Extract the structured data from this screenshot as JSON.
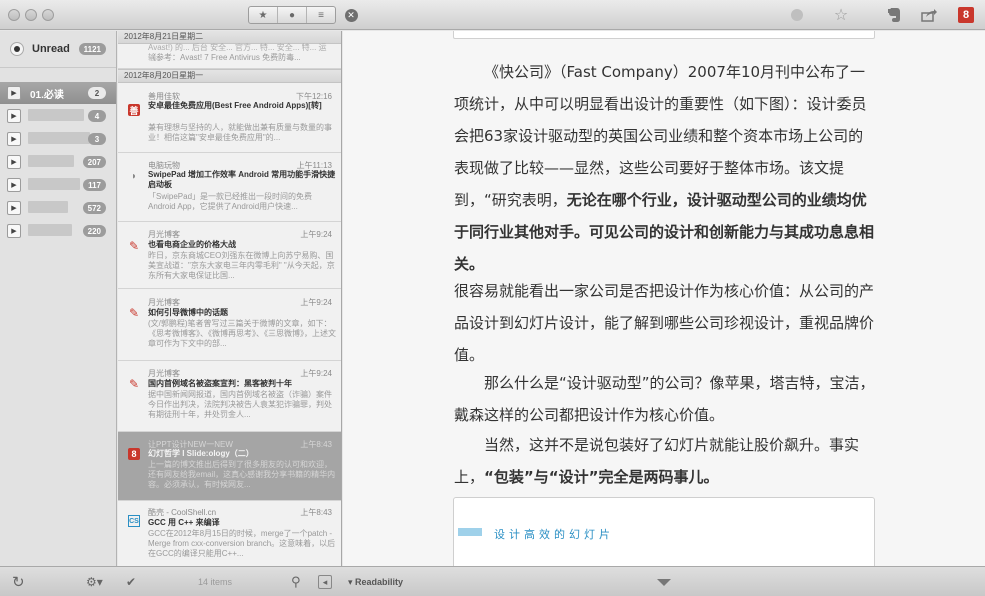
{
  "toolbar": {
    "segments": [
      "★",
      "●",
      "≡"
    ],
    "close_glyph": "✕",
    "star_glyph": "☆",
    "evernote_glyph": "🐘",
    "share_glyph": "⇪",
    "readitlater_glyph": "8"
  },
  "sidebar": {
    "unread_label": "Unread",
    "unread_count": "1121",
    "folders": [
      {
        "label": "01.必读",
        "count": "2"
      },
      {
        "label": "",
        "count": "4"
      },
      {
        "label": "",
        "count": "3"
      },
      {
        "label": "",
        "count": "207"
      },
      {
        "label": "",
        "count": "117"
      },
      {
        "label": "",
        "count": "572"
      },
      {
        "label": "",
        "count": "220"
      }
    ]
  },
  "list": {
    "partial_item": {
      "line1": "Avast!) 的... 后台 安全... 官方... 特... 安全... 特... 运输...",
      "line2": "（参考：Avast! 7 Free Antivirus 免费防毒..."
    },
    "date_headers": [
      "2012年8月21日星期二",
      "2012年8月20日星期一"
    ],
    "items": [
      {
        "source": "善用佳软",
        "time": "下午12:16",
        "title": "安卓最佳免费应用(Best Free Android Apps)[转]",
        "summary": "兼有理想与坚持的人，就能做出兼有质量与数量的事业！相信这篇\"安卓最佳免费应用\"的..."
      },
      {
        "source": "电脑玩物",
        "time": "上午11:13",
        "title": "SwipePad 增加工作效率 Android 常用功能手滑快捷启动板",
        "summary": "「SwipePad」是一款已经推出一段时间的免费Android App，它提供了Android用户快速..."
      },
      {
        "source": "月光博客",
        "time": "上午9:24",
        "title": "也看电商企业的价格大战",
        "summary": "昨日，京东商城CEO刘强东在微博上向苏宁易购、国美宣战道：\"京东大家电三年内零毛利\" \"从今天起，京东所有大家电保证比国..."
      },
      {
        "source": "月光博客",
        "time": "上午9:24",
        "title": "如何引导微博中的话题",
        "summary": "(文/郭鹏程)笔者曾写过三篇关于微博的文章，如下：《思考微博客》、《微博再思考》、《三思微博》，上述文章可作为下文中的部..."
      },
      {
        "source": "月光博客",
        "time": "上午9:24",
        "title": "国内首例域名被盗案宣判：黑客被判十年",
        "summary": "据中国新闻网报道，国内首例域名被盗（诈骗）案件今日作出判决，法院判决被告人袁某犯诈骗罪，判处有期徒刑十年，并处罚金人..."
      },
      {
        "source": "让PPT设计NEW一NEW",
        "time": "上午8:43",
        "title": "幻灯哲学 I Slide:ology（二）",
        "summary": "上一篇的博文推出后得到了很多朋友的认可和欢迎，还有网友给我email，这真心感谢我分享书籍的精华内容。必须承认，有时候网友..."
      },
      {
        "source": "酷壳 - CoolShell.cn",
        "time": "上午8:43",
        "title": "GCC 用 C++ 来编译",
        "summary": "GCC在2012年8月15日的时候，merge了一个patch - Merge from cxx-conversion branch。这意味着，以后在GCC的编译只能用C++..."
      }
    ]
  },
  "reader": {
    "paragraphs": [
      "《快公司》（Fast Company）2007年10月刊中公布了一项统计，从中可以明显看出设计的重要性（如下图）：设计委员会把63家设计驱动型的英国公司业绩和整个资本市场上公司的表现做了比较——显然，这些公司要好于整体市场。该文提到，“研究表明，",
      "无论在哪个行业，设计驱动型公司的业绩均优于同行业其他对手。可见公司的设计和创新能力与其成功息息相关。",
      "很容易就能看出一家公司是否把设计作为核心价值：从公司的产品设计到幻灯片设计，能了解到哪些公司珍视设计，重视品牌价值。",
      "那么什么是“设计驱动型”的公司？像苹果，塔吉特，宝洁，戴森这样的公司都把设计作为核心价值。",
      "当然，这并不是说包装好了幻灯片就能让股价飙升。事实上，",
      "“包装”与“设计”完全是两码事儿。"
    ],
    "embed_text": "设计高效的幻灯片"
  },
  "bottombar": {
    "refresh_glyph": "↻",
    "gear_glyph": "⚙▾",
    "check_glyph": "✔",
    "item_count": "14 items",
    "search_glyph": "⚲",
    "collapse_glyph": "◂",
    "readability_label": "▾ Readability"
  }
}
